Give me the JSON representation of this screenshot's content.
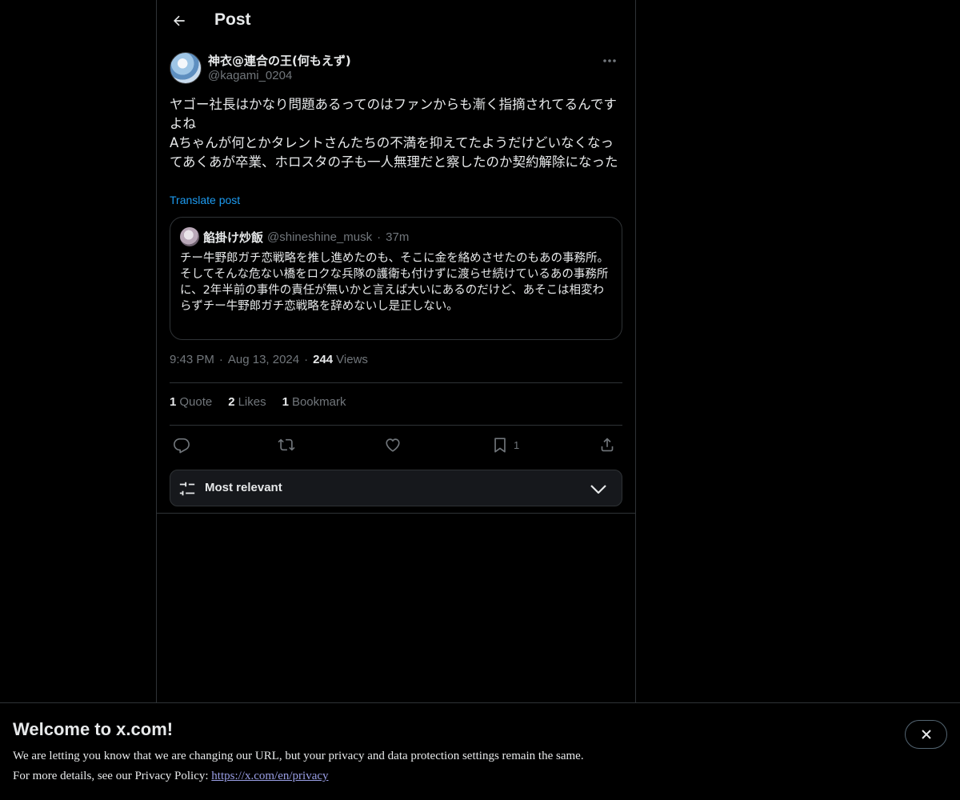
{
  "header": {
    "title": "Post"
  },
  "post": {
    "author": {
      "display_name": "神衣@連合の王(何もえず)",
      "handle": "@kagami_0204"
    },
    "text": "ヤゴー社長はかなり問題あるってのはファンからも漸く指摘されてるんですよね\nAちゃんが何とかタレントさんたちの不満を抑えてたようだけどいなくなってあくあが卒業、ホロスタの子も一人無理だと察したのか契約解除になった",
    "translate_label": "Translate post",
    "quote": {
      "display_name": "餡掛け炒飯",
      "handle": "@shineshine_musk",
      "dot": "·",
      "time": "37m",
      "text": "チー牛野郎ガチ恋戦略を推し進めたのも、そこに金を絡めさせたのもあの事務所。\nそしてそんな危ない橋をロクな兵隊の護衛も付けずに渡らせ続けているあの事務所に、2年半前の事件の責任が無いかと言えば大いにあるのだけど、あそこは相変わらずチー牛野郎ガチ恋戦略を辞めないし是正しない。"
    },
    "meta": {
      "time": "9:43 PM",
      "sep": "·",
      "date": "Aug 13, 2024",
      "views_count": "244",
      "views_label": "Views"
    },
    "stats": {
      "quote_count": "1",
      "quote_label": "Quote",
      "likes_count": "2",
      "likes_label": "Likes",
      "bookmark_count": "1",
      "bookmark_label": "Bookmark"
    },
    "actions": {
      "reply_icon": "reply-icon",
      "repost_icon": "repost-icon",
      "like_icon": "heart-icon",
      "bookmark_icon": "bookmark-icon",
      "bookmark_count": "1",
      "share_icon": "share-icon"
    }
  },
  "replies_sort": {
    "label": "Most relevant"
  },
  "banner": {
    "title": "Welcome to x.com!",
    "line1": "We are letting you know that we are changing our URL, but your privacy and data protection settings remain the same.",
    "line2_prefix": "For more details, see our Privacy Policy: ",
    "link": "https://x.com/en/privacy"
  },
  "colors": {
    "background": "#000000",
    "text": "#e7e9ea",
    "muted": "#71767b",
    "accent": "#1d9bf0",
    "border": "#2f3336"
  }
}
